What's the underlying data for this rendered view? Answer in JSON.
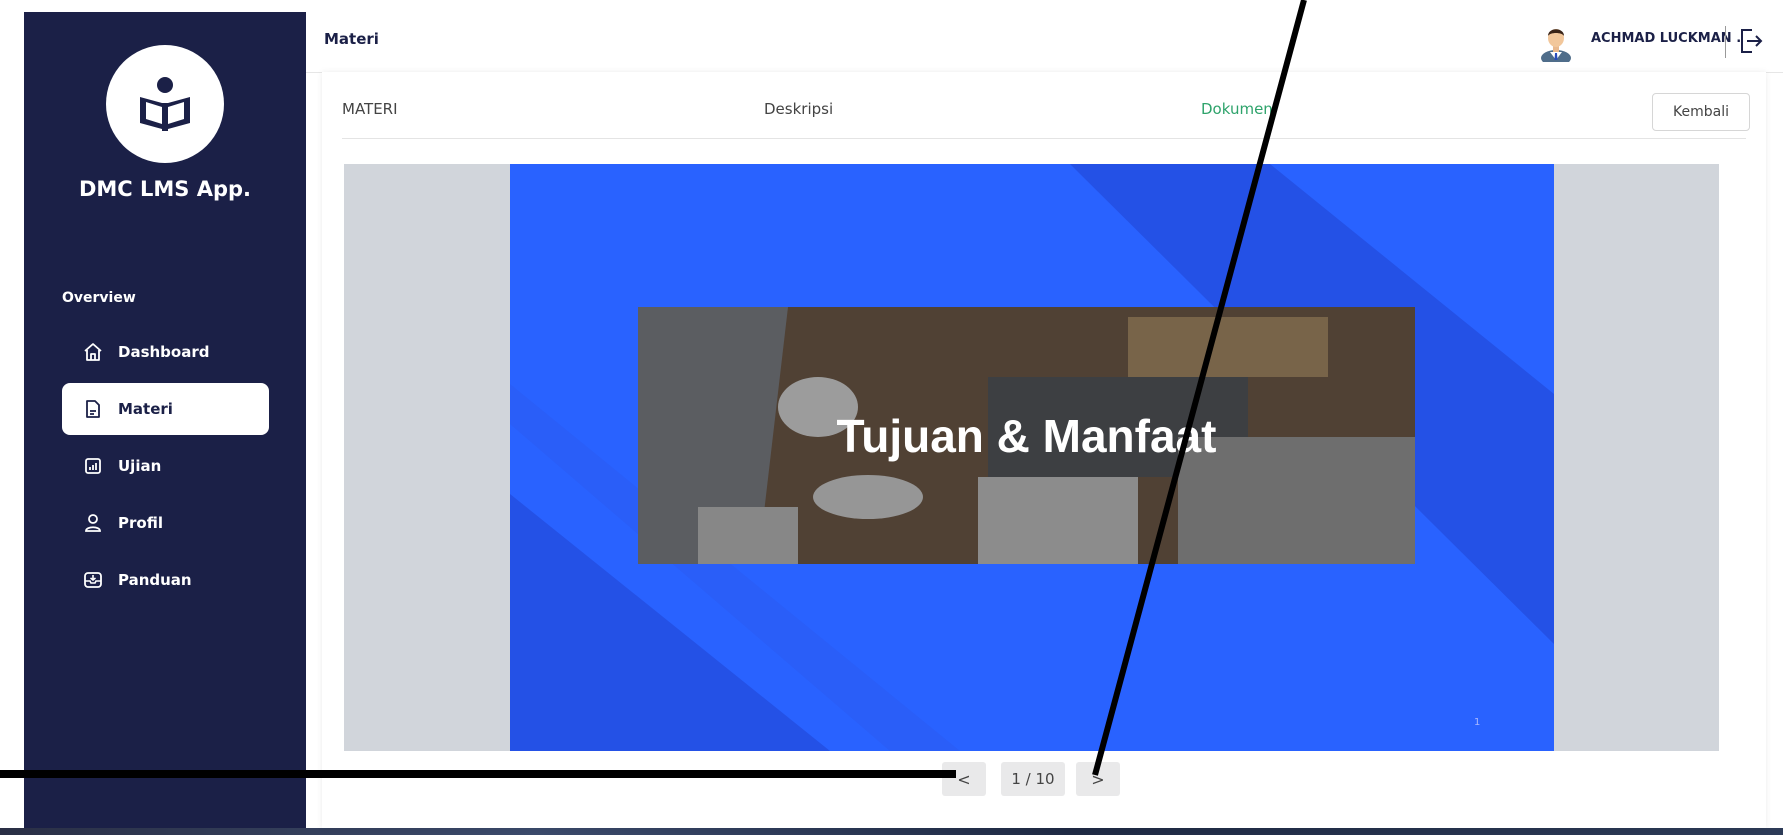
{
  "sidebar": {
    "app_name": "DMC LMS App.",
    "section_label": "Overview",
    "items": [
      {
        "label": "Dashboard",
        "icon": "home-icon"
      },
      {
        "label": "Materi",
        "icon": "document-icon",
        "active": true
      },
      {
        "label": "Ujian",
        "icon": "chart-box-icon"
      },
      {
        "label": "Profil",
        "icon": "user-icon"
      },
      {
        "label": "Panduan",
        "icon": "inbox-icon"
      }
    ]
  },
  "header": {
    "title": "Materi",
    "user_name": "ACHMAD LUCKMAN .",
    "logout_icon": "logout-icon"
  },
  "tabs": {
    "materi": "MATERI",
    "deskripsi": "Deskripsi",
    "dokumen": "Dokumen",
    "back_label": "Kembali"
  },
  "slide": {
    "title": "Tujuan & Manfaat",
    "page_number": "1"
  },
  "pager": {
    "prev": "<",
    "counter": "1 / 10",
    "next": ">"
  },
  "colors": {
    "sidebar_bg": "#1b2047",
    "slide_blue": "#2962ff",
    "active_tab": "#2ea36b"
  }
}
